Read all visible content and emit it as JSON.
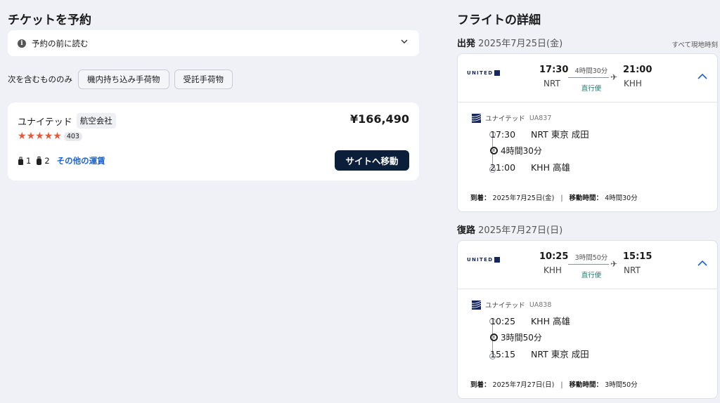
{
  "left": {
    "title": "チケットを予約",
    "notice": "予約の前に読む",
    "include_label": "次を含むもののみ",
    "chips": [
      "機内持ち込み手荷物",
      "受託手荷物"
    ],
    "offer": {
      "airline": "ユナイテッド",
      "airline_tag": "航空会社",
      "price": "¥166,490",
      "rating_count": "403",
      "rating_stars": 5,
      "carry_on_count": "1",
      "checked_count": "2",
      "other_fares": "その他の運賃",
      "go_button": "サイトへ移動"
    }
  },
  "right": {
    "title": "フライトの詳細",
    "local_time_note": "すべて現地時刻",
    "logo_text": "UNITED",
    "outbound": {
      "label": "出発",
      "date": "2025年7月25日(金)",
      "dep_time": "17:30",
      "dep_code": "NRT",
      "arr_time": "21:00",
      "arr_code": "KHH",
      "duration": "4時間30分",
      "direct": "直行便",
      "carrier": "ユナイテッド",
      "flight_no": "UA837",
      "from_time": "17:30",
      "from_place": "NRT 東京 成田",
      "seg_duration": "4時間30分",
      "to_time": "21:00",
      "to_place": "KHH 高雄",
      "arrive_label": "到着：",
      "arrive_date": "2025年7月25日(金)",
      "travel_label": "移動時間：",
      "travel_time": "4時間30分"
    },
    "return": {
      "label": "復路",
      "date": "2025年7月27日(日)",
      "dep_time": "10:25",
      "dep_code": "KHH",
      "arr_time": "15:15",
      "arr_code": "NRT",
      "duration": "3時間50分",
      "direct": "直行便",
      "carrier": "ユナイテッド",
      "flight_no": "UA838",
      "from_time": "10:25",
      "from_place": "KHH 高雄",
      "seg_duration": "3時間50分",
      "to_time": "15:15",
      "to_place": "NRT 東京 成田",
      "arrive_label": "到着：",
      "arrive_date": "2025年7月27日(日)",
      "travel_label": "移動時間：",
      "travel_time": "3時間50分"
    }
  },
  "colors": {
    "accent": "#1a62d6",
    "star": "#e55a3c",
    "button": "#0b1f3a",
    "direct": "#1a7a6c",
    "united_navy": "#16265f"
  }
}
